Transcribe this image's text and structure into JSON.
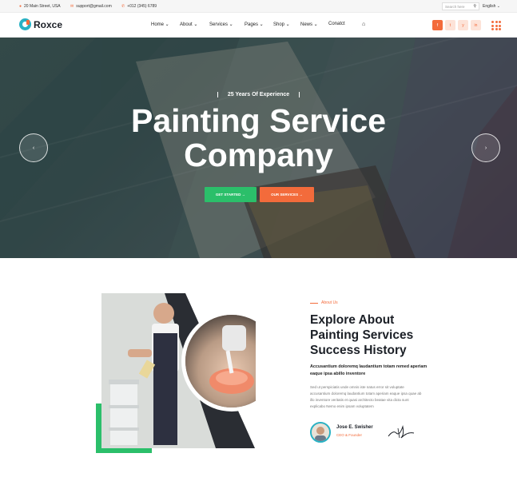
{
  "topbar": {
    "address": "20 Main Street, USA",
    "email": "support@gmail.com",
    "phone": "+012 (345) 6789",
    "search_placeholder": "Search here",
    "language": "English"
  },
  "brand": {
    "name": "Roxce"
  },
  "nav": {
    "items": [
      {
        "label": "Home",
        "dropdown": true
      },
      {
        "label": "About",
        "dropdown": true
      },
      {
        "label": "Services",
        "dropdown": true
      },
      {
        "label": "Pages",
        "dropdown": true
      },
      {
        "label": "Shop",
        "dropdown": true
      },
      {
        "label": "News",
        "dropdown": true
      },
      {
        "label": "Conatct",
        "dropdown": false
      }
    ],
    "social": [
      "f",
      "t",
      "y",
      "in"
    ]
  },
  "hero": {
    "kicker": "25 Years Of Experience",
    "title_line1": "Painting Service",
    "title_line2": "Company",
    "btn_primary": "GET STARTED",
    "btn_secondary": "OUR SERVICES"
  },
  "about": {
    "label": "About Us",
    "title": "Explore About Painting Services Success History",
    "lead": "Accusantium doloremq laudantium totam remed aperiam eaque ipsa abillo inventore",
    "body": "Sed ut perspiciatis unde omnis iste natus error sit voluptate accusantium doloremq laudantium totam aperiam eaque ipsa quae ab illo inventore veritatis et quasi architecto beatae vita dicta sunt explicabo Nemo enim ipsam voluptatem",
    "author_name": "Jose E. Swisher",
    "author_role": "CEO & Founder"
  },
  "colors": {
    "accent": "#f36b3b",
    "green": "#2bbf6a",
    "teal": "#28b1c4",
    "dark": "#1b1f26"
  }
}
